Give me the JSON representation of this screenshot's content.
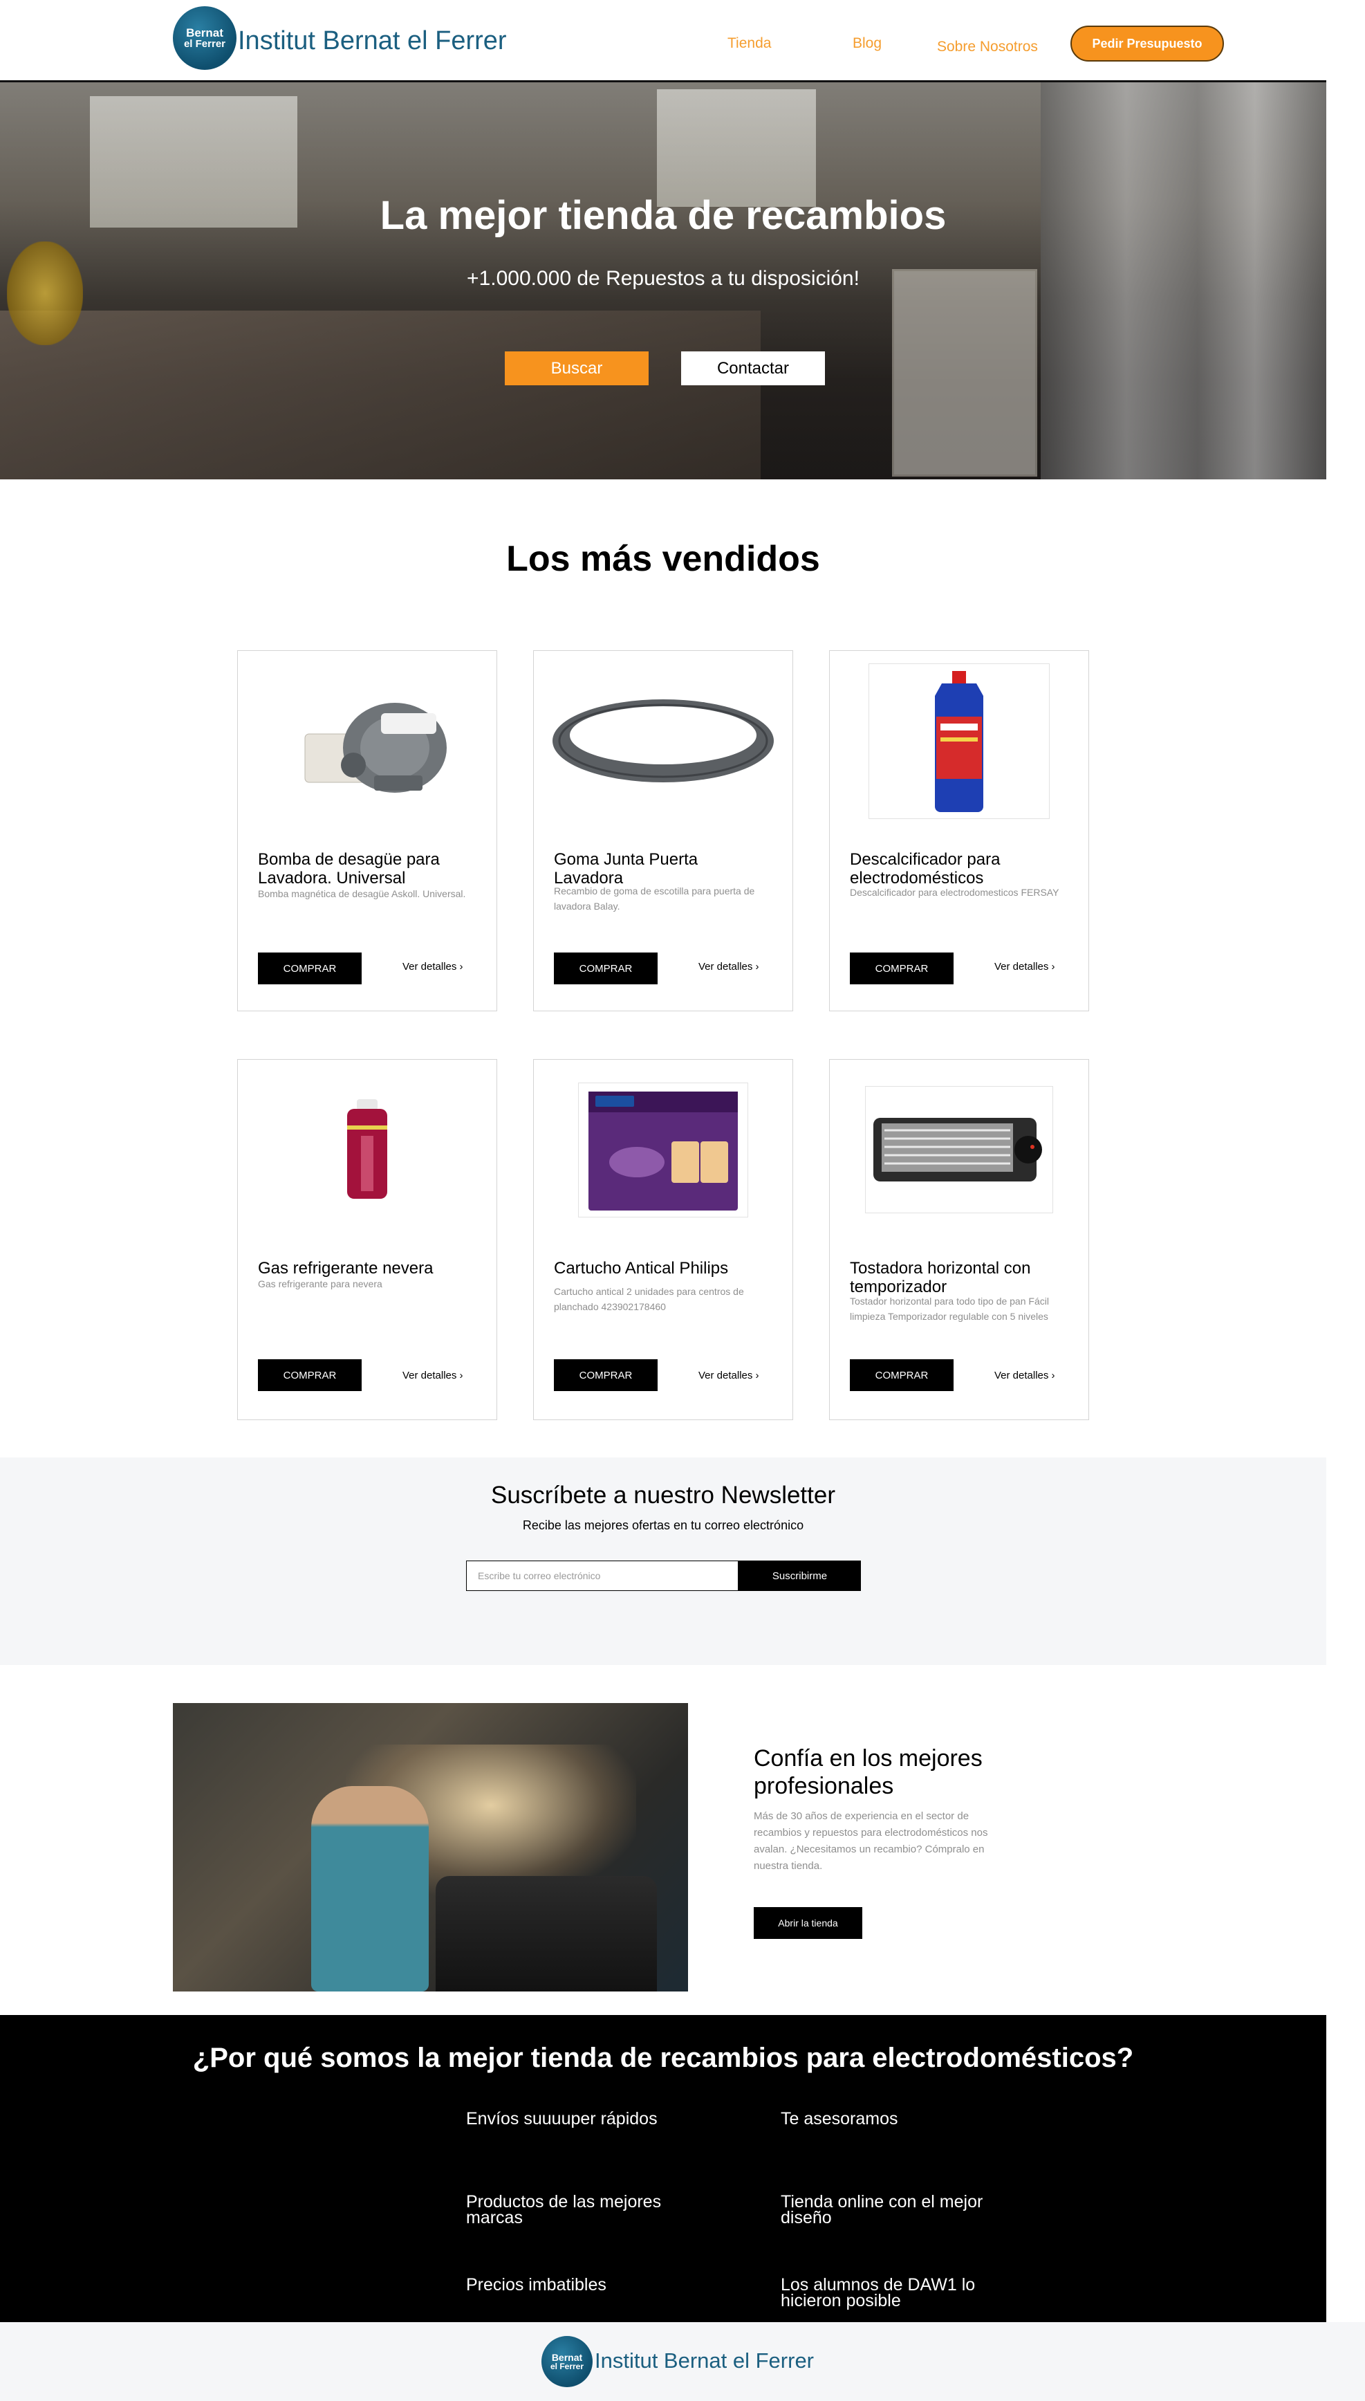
{
  "header": {
    "logo_line1": "Bernat",
    "logo_line2": "el Ferrer",
    "brand": "Institut Bernat el Ferrer",
    "nav": [
      "Tienda",
      "Blog",
      "Sobre Nosotros"
    ],
    "cta": "Pedir Presupuesto"
  },
  "hero": {
    "title": "La mejor tienda de recambios",
    "subtitle": "+1.000.000 de Repuestos a tu disposición!",
    "search_label": "Buscar",
    "contact_label": "Contactar"
  },
  "bestsellers": {
    "title": "Los más vendidos",
    "buy_label": "COMPRAR",
    "more_label": "Ver detalles",
    "products": [
      {
        "name": "Bomba de desagüe para Lavadora. Universal",
        "desc": "Bomba magnética de desagüe Askoll. Universal."
      },
      {
        "name": "Goma Junta Puerta Lavadora",
        "desc": "Recambio de goma de escotilla para puerta de lavadora Balay."
      },
      {
        "name": "Descalcificador para electrodomésticos",
        "desc": "Descalcificador para electrodomesticos FERSAY"
      },
      {
        "name": "Gas refrigerante nevera",
        "desc": "Gas refrigerante para nevera"
      },
      {
        "name": "Cartucho Antical Philips",
        "desc": "Cartucho antical 2 unidades para centros de planchado 423902178460"
      },
      {
        "name": "Tostadora horizontal con temporizador",
        "desc": "Tostador horizontal para todo tipo de pan Fácil limpieza Temporizador regulable con 5 niveles"
      }
    ]
  },
  "newsletter": {
    "title": "Suscríbete a nuestro Newsletter",
    "subtitle": "Recibe las mejores ofertas en tu correo electrónico",
    "placeholder": "Escribe tu correo electrónico",
    "button": "Suscribirme"
  },
  "trust": {
    "title": "Confía en los  mejores profesionales",
    "text": "Más de 30 años de experiencia en el sector de recambios y repuestos para electrodomésticos nos avalan. ¿Necesitamos un recambio? Cómpralo en nuestra tienda.",
    "button": "Abrir la tienda"
  },
  "why": {
    "title": "¿Por qué somos la mejor tienda de recambios para electrodomésticos?",
    "items": [
      "Envíos suuuuper rápidos",
      "Te asesoramos",
      "Productos de las mejores marcas",
      "Tienda online con el mejor diseño",
      "Precios imbatibles",
      "Los alumnos de DAW1 lo hicieron posible"
    ]
  },
  "footer": {
    "logo_line1": "Bernat",
    "logo_line2": "el Ferrer",
    "brand": "Institut Bernat el Ferrer"
  },
  "colors": {
    "accent": "#f7931e",
    "brand_blue": "#1b5f80",
    "dark": "#000000",
    "light_bg": "#f5f6f8"
  }
}
